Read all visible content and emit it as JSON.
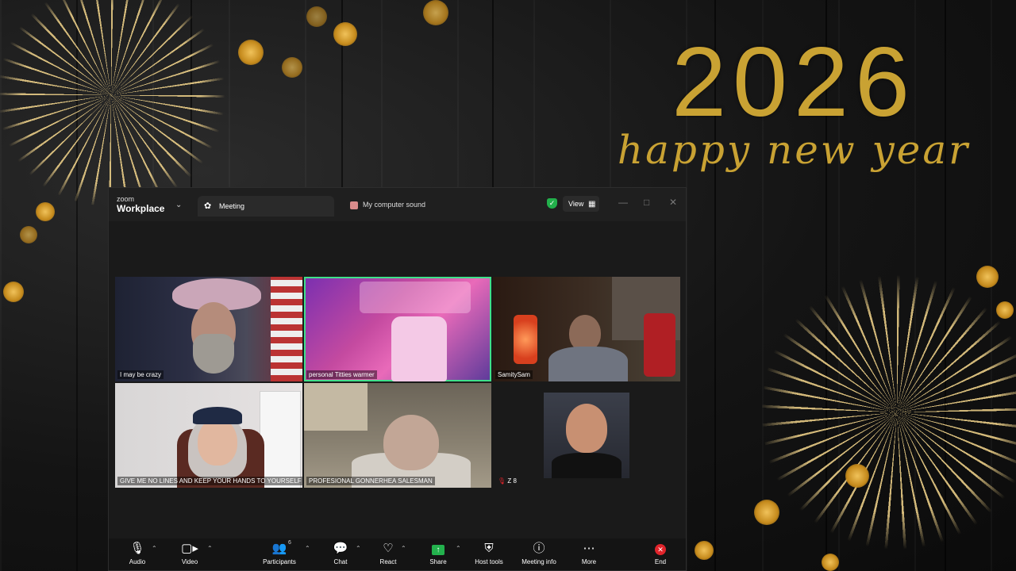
{
  "background": {
    "year": "2026",
    "greeting": "happy new year"
  },
  "window": {
    "brand_small": "zoom",
    "brand_large": "Workplace",
    "tab_meeting": "Meeting",
    "tab_sound": "My computer sound",
    "view_label": "View"
  },
  "participants": [
    {
      "name": "I may be crazy"
    },
    {
      "name": "personal Titties warmer"
    },
    {
      "name": "SamitySam"
    },
    {
      "name": "GIVE ME NO LINES AND KEEP YOUR HANDS TO YOURSELF"
    },
    {
      "name": "PROFESIONAL GONNERHEA SALESMAN"
    },
    {
      "name": "Z 8"
    }
  ],
  "toolbar": {
    "audio": "Audio",
    "video": "Video",
    "participants": "Participants",
    "participants_count": "6",
    "chat": "Chat",
    "react": "React",
    "share": "Share",
    "host_tools": "Host tools",
    "meeting_info": "Meeting info",
    "more": "More",
    "end": "End"
  },
  "colors": {
    "gold": "#c9a233",
    "active_speaker": "#3fe08a",
    "share_green": "#23b14d",
    "end_red": "#e0242b"
  }
}
